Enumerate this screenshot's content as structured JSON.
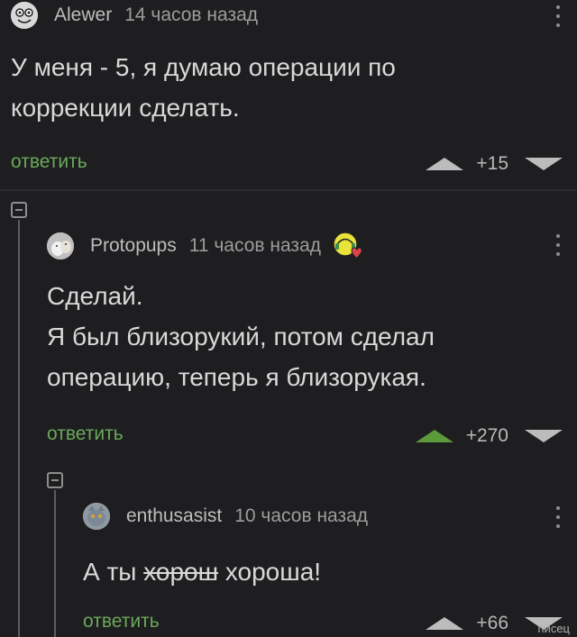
{
  "comments": [
    {
      "author": "Alewer",
      "time": "14 часов назад",
      "text_lines": [
        "У меня - 5, я думаю операции по",
        "коррекции сделать."
      ],
      "reply_label": "ответить",
      "score": "+15",
      "upvoted": false
    },
    {
      "author": "Protopups",
      "time": "11 часов назад",
      "text_lines": [
        "Сделай.",
        "Я был близорукий, потом сделал",
        "операцию, теперь я близорукая."
      ],
      "reply_label": "ответить",
      "score": "+270",
      "upvoted": true
    },
    {
      "author": "enthusasist",
      "time": "10 часов назад",
      "text_prefix": "А ты ",
      "text_struck": "хорош",
      "text_suffix": " хороша!",
      "reply_label": "ответить",
      "score": "+66",
      "upvoted": false
    }
  ],
  "icons": {
    "avatar_1": "sponge-face-avatar-icon",
    "avatar_2": "animals-avatar-icon",
    "avatar_3": "cat-avatar-icon",
    "badge": "heart-badge-icon",
    "more": "vertical-dots-icon",
    "collapse": "collapse-minus-icon",
    "upvote": "triangle-up-icon",
    "downvote": "triangle-down-icon"
  },
  "colors": {
    "background": "#1e1e20",
    "reply_link": "#6aa85a",
    "upvote_active": "#5c9a3b"
  },
  "watermark": "писец"
}
